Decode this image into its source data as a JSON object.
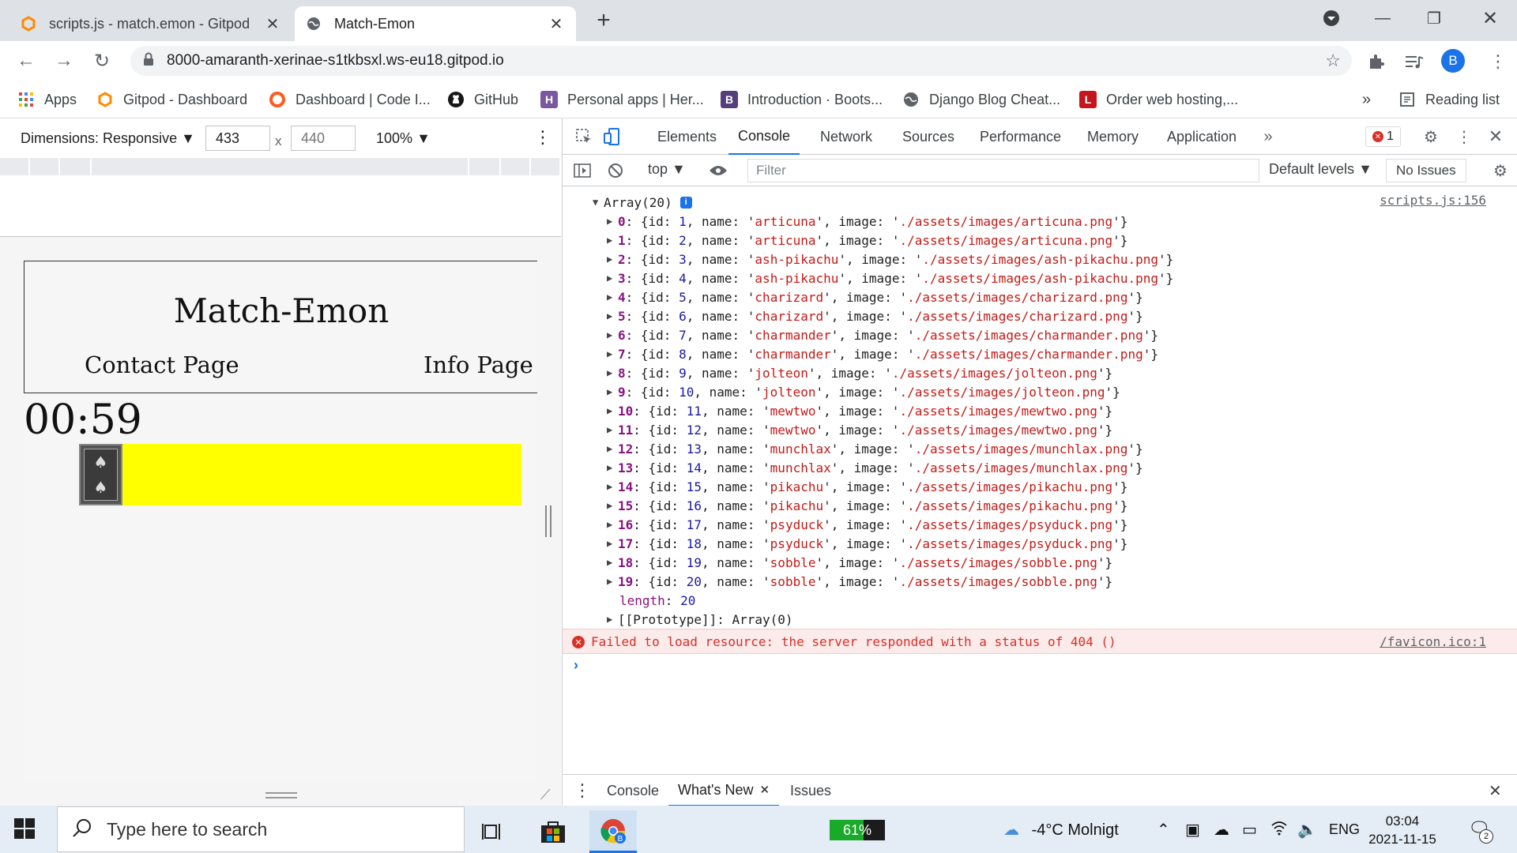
{
  "tabs": [
    {
      "title": "scripts.js - match.emon - Gitpod",
      "icon": "gitpod-icon",
      "active": false
    },
    {
      "title": "Match-Emon",
      "icon": "globe-icon",
      "active": true
    }
  ],
  "omnibox": {
    "url": "8000-amaranth-xerinae-s1tkbsxl.ws-eu18.gitpod.io",
    "profile_initial": "B"
  },
  "bookmarks": [
    {
      "label": "Apps",
      "icon": "apps-grid-icon"
    },
    {
      "label": "Gitpod - Dashboard",
      "icon": "gitpod-icon"
    },
    {
      "label": "Dashboard | Code I...",
      "icon": "code-institute-icon"
    },
    {
      "label": "GitHub",
      "icon": "github-icon"
    },
    {
      "label": "Personal apps | Her...",
      "icon": "heroku-icon"
    },
    {
      "label": "Introduction · Boots...",
      "icon": "bootstrap-icon"
    },
    {
      "label": "Django Blog Cheat...",
      "icon": "globe-icon"
    },
    {
      "label": "Order web hosting,...",
      "icon": "hosting-icon"
    }
  ],
  "bookmarks_more": "»",
  "reading_list": "Reading list",
  "device_toolbar": {
    "dimensions": "Dimensions: Responsive",
    "width": "433",
    "height_placeholder": "440",
    "times": "x",
    "zoom": "100%"
  },
  "site": {
    "title": "Match-Emon",
    "nav": [
      "Contact Page",
      "Info Page"
    ],
    "timer": "00:59"
  },
  "devtools": {
    "tabs": [
      "Elements",
      "Console",
      "Network",
      "Sources",
      "Performance",
      "Memory",
      "Application"
    ],
    "active_tab": "Console",
    "error_count": "1",
    "context": "top",
    "filter_placeholder": "Filter",
    "levels": "Default levels",
    "issues": "No Issues",
    "array_header": "Array(20)",
    "source_link": "scripts.js:156",
    "entries": [
      {
        "index": "0",
        "id": "1",
        "name": "articuna",
        "image": "./assets/images/articuna.png"
      },
      {
        "index": "1",
        "id": "2",
        "name": "articuna",
        "image": "./assets/images/articuna.png"
      },
      {
        "index": "2",
        "id": "3",
        "name": "ash-pikachu",
        "image": "./assets/images/ash-pikachu.png"
      },
      {
        "index": "3",
        "id": "4",
        "name": "ash-pikachu",
        "image": "./assets/images/ash-pikachu.png"
      },
      {
        "index": "4",
        "id": "5",
        "name": "charizard",
        "image": "./assets/images/charizard.png"
      },
      {
        "index": "5",
        "id": "6",
        "name": "charizard",
        "image": "./assets/images/charizard.png"
      },
      {
        "index": "6",
        "id": "7",
        "name": "charmander",
        "image": "./assets/images/charmander.png"
      },
      {
        "index": "7",
        "id": "8",
        "name": "charmander",
        "image": "./assets/images/charmander.png"
      },
      {
        "index": "8",
        "id": "9",
        "name": "jolteon",
        "image": "./assets/images/jolteon.png"
      },
      {
        "index": "9",
        "id": "10",
        "name": "jolteon",
        "image": "./assets/images/jolteon.png"
      },
      {
        "index": "10",
        "id": "11",
        "name": "mewtwo",
        "image": "./assets/images/mewtwo.png"
      },
      {
        "index": "11",
        "id": "12",
        "name": "mewtwo",
        "image": "./assets/images/mewtwo.png"
      },
      {
        "index": "12",
        "id": "13",
        "name": "munchlax",
        "image": "./assets/images/munchlax.png"
      },
      {
        "index": "13",
        "id": "14",
        "name": "munchlax",
        "image": "./assets/images/munchlax.png"
      },
      {
        "index": "14",
        "id": "15",
        "name": "pikachu",
        "image": "./assets/images/pikachu.png"
      },
      {
        "index": "15",
        "id": "16",
        "name": "pikachu",
        "image": "./assets/images/pikachu.png"
      },
      {
        "index": "16",
        "id": "17",
        "name": "psyduck",
        "image": "./assets/images/psyduck.png"
      },
      {
        "index": "17",
        "id": "18",
        "name": "psyduck",
        "image": "./assets/images/psyduck.png"
      },
      {
        "index": "18",
        "id": "19",
        "name": "sobble",
        "image": "./assets/images/sobble.png"
      },
      {
        "index": "19",
        "id": "20",
        "name": "sobble",
        "image": "./assets/images/sobble.png"
      }
    ],
    "length_label": "length",
    "length_value": "20",
    "prototype": "[[Prototype]]: Array(0)",
    "error_message": "Failed to load resource: the server responded with a status of 404 ()",
    "error_source": "/favicon.ico:1",
    "drawer_tabs": [
      "Console",
      "What's New",
      "Issues"
    ],
    "drawer_active": "What's New"
  },
  "taskbar": {
    "search_placeholder": "Type here to search",
    "battery": "61%",
    "battery_level": 0.61,
    "weather": "-4°C  Molnigt",
    "language": "ENG",
    "time": "03:04",
    "date": "2021-11-15",
    "notifications": "2"
  },
  "colors": {
    "accent": "#1a73e8",
    "error": "#d93025",
    "card_row": "#ffff00",
    "string": "#c41a16"
  }
}
